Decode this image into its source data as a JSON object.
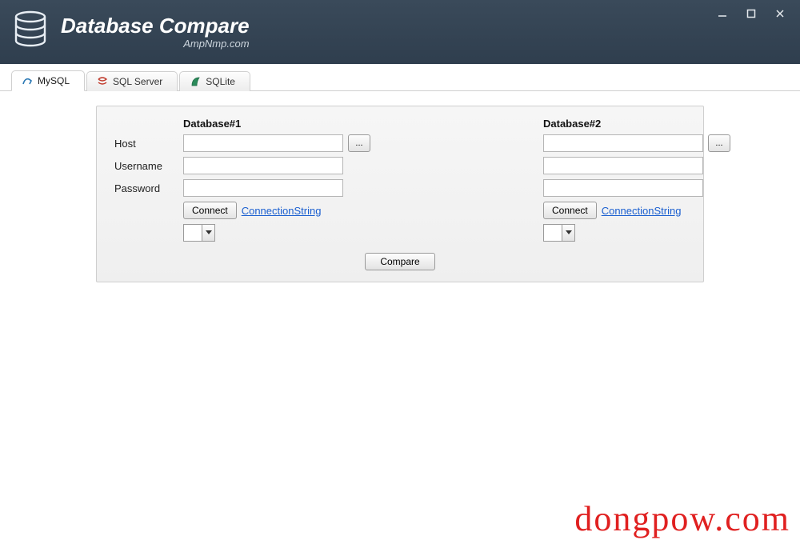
{
  "app": {
    "title": "Database Compare",
    "subtitle": "AmpNmp.com"
  },
  "tabs": [
    {
      "label": "MySQL"
    },
    {
      "label": "SQL Server"
    },
    {
      "label": "SQLite"
    }
  ],
  "labels": {
    "host": "Host",
    "username": "Username",
    "password": "Password"
  },
  "db1": {
    "header": "Database#1",
    "host": "",
    "username": "",
    "password": "",
    "connect": "Connect",
    "connstr": "ConnectionString",
    "browse": "...",
    "selected": ""
  },
  "db2": {
    "header": "Database#2",
    "host": "",
    "username": "",
    "password": "",
    "connect": "Connect",
    "connstr": "ConnectionString",
    "browse": "...",
    "selected": ""
  },
  "actions": {
    "compare": "Compare"
  },
  "watermark": "dongpow.com"
}
